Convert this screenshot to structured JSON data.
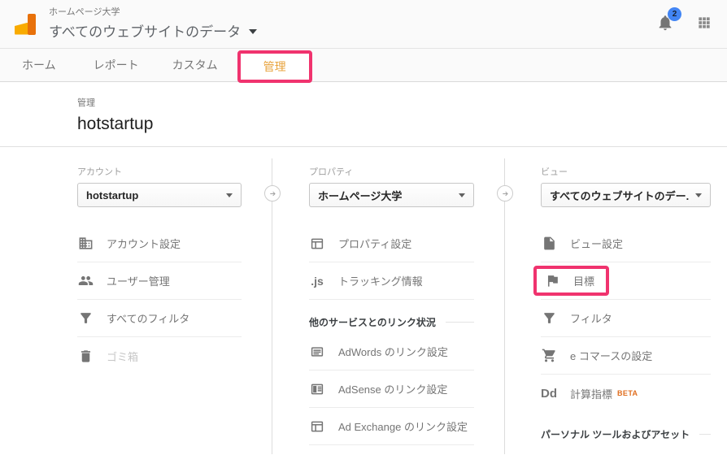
{
  "colors": {
    "highlight_pink": "#f0336e",
    "accent_orange": "#e8a33d",
    "beta_orange": "#e06e1f",
    "badge_blue": "#4285f4",
    "logo_dark_orange": "#e8710a",
    "logo_light_orange": "#f9ab00"
  },
  "header": {
    "account_name": "ホームページ大学",
    "view_selector": "すべてのウェブサイトのデータ",
    "notification_count": "2",
    "icons": [
      "analytics-logo",
      "bell-icon",
      "apps-grid-icon"
    ]
  },
  "nav": {
    "items": [
      {
        "id": "home",
        "label": "ホーム",
        "active": false,
        "highlighted": false
      },
      {
        "id": "report",
        "label": "レポート",
        "active": false,
        "highlighted": false
      },
      {
        "id": "custom",
        "label": "カスタム",
        "active": false,
        "highlighted": false
      },
      {
        "id": "admin",
        "label": "管理",
        "active": true,
        "highlighted": true
      }
    ]
  },
  "page": {
    "breadcrumb": "管理",
    "title": "hotstartup"
  },
  "admin": {
    "columns": [
      {
        "id": "account",
        "label": "アカウント",
        "selected_value": "hotstartup",
        "rows": [
          {
            "type": "item",
            "id": "account-settings",
            "icon": "building-icon",
            "label": "アカウント設定"
          },
          {
            "type": "item",
            "id": "user-management",
            "icon": "people-icon",
            "label": "ユーザー管理"
          },
          {
            "type": "item",
            "id": "all-filters",
            "icon": "filter-icon",
            "label": "すべてのフィルタ"
          },
          {
            "type": "item",
            "id": "trash",
            "icon": "trash-icon",
            "label": "ゴミ箱",
            "disabled": true,
            "divider": false
          }
        ]
      },
      {
        "id": "property",
        "label": "プロパティ",
        "selected_value": "ホームページ大学",
        "rows": [
          {
            "type": "item",
            "id": "property-settings",
            "icon": "layout-outline-icon",
            "label": "プロパティ設定"
          },
          {
            "type": "item",
            "id": "tracking-info",
            "icon": "js-icon",
            "label": "トラッキング情報"
          },
          {
            "type": "section",
            "label": "他のサービスとのリンク状況"
          },
          {
            "type": "item",
            "id": "adwords-link",
            "icon": "lines-icon",
            "label": "AdWords のリンク設定"
          },
          {
            "type": "item",
            "id": "adsense-link",
            "icon": "layout-filled-icon",
            "label": "AdSense のリンク設定"
          },
          {
            "type": "item",
            "id": "adexchange-link",
            "icon": "layout-outline-icon",
            "label": "Ad Exchange のリンク設定"
          }
        ]
      },
      {
        "id": "view",
        "label": "ビュー",
        "selected_value": "すべてのウェブサイトのデー...",
        "rows": [
          {
            "type": "item",
            "id": "view-settings",
            "icon": "file-icon",
            "label": "ビュー設定"
          },
          {
            "type": "item",
            "id": "goals",
            "icon": "flag-icon",
            "label": "目標",
            "highlighted": true
          },
          {
            "type": "item",
            "id": "filters",
            "icon": "filter-icon",
            "label": "フィルタ"
          },
          {
            "type": "item",
            "id": "ecommerce-settings",
            "icon": "cart-icon",
            "label": "e コマースの設定"
          },
          {
            "type": "item",
            "id": "calculated-metrics",
            "icon": "dd-icon",
            "label": "計算指標",
            "badge": "BETA",
            "divider": false
          },
          {
            "type": "section",
            "label": "パーソナル ツールおよびアセット"
          }
        ]
      }
    ]
  }
}
